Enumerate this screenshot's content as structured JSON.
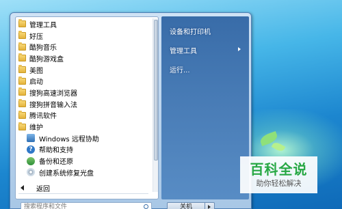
{
  "programs": [
    {
      "label": "管理工具",
      "icon": "folder-icon"
    },
    {
      "label": "好压",
      "icon": "folder-icon"
    },
    {
      "label": "酷狗音乐",
      "icon": "folder-icon"
    },
    {
      "label": "酷狗游戏盒",
      "icon": "folder-icon"
    },
    {
      "label": "美图",
      "icon": "folder-icon"
    },
    {
      "label": "启动",
      "icon": "folder-icon"
    },
    {
      "label": "搜狗高速浏览器",
      "icon": "folder-icon"
    },
    {
      "label": "搜狗拼音输入法",
      "icon": "folder-icon"
    },
    {
      "label": "腾讯软件",
      "icon": "folder-icon"
    },
    {
      "label": "维护",
      "icon": "folder-icon"
    }
  ],
  "maintenance_items": [
    {
      "label": "Windows 远程协助",
      "icon": "remote-assistance-icon"
    },
    {
      "label": "帮助和支持",
      "icon": "help-icon"
    },
    {
      "label": "备份和还原",
      "icon": "backup-icon"
    },
    {
      "label": "创建系统修复光盘",
      "icon": "disc-icon"
    }
  ],
  "back_label": "返回",
  "search_placeholder": "搜索程序和文件",
  "right_items": [
    {
      "label": "设备和打印机"
    },
    {
      "label": "管理工具"
    },
    {
      "label": "运行..."
    }
  ],
  "shutdown_label": "关机",
  "watermark": {
    "title": "百科全说",
    "subtitle": "助你轻松解决"
  },
  "colors": {
    "accent_green": "#27a844",
    "menu_blue": "#2c66a8"
  }
}
